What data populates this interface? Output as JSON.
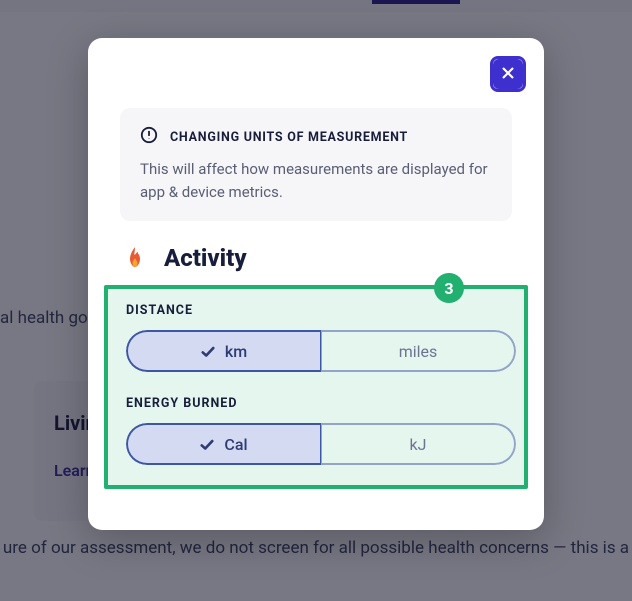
{
  "background": {
    "goal_fragment": "al health goa",
    "card_title": "Livin                              Conc",
    "card_learn": "Learn",
    "footer_text": "ure of our assessment, we do not screen for all possible health concerns — this is a"
  },
  "modal": {
    "note": {
      "title": "CHANGING UNITS OF MEASUREMENT",
      "desc": "This will affect how measurements are displayed for app & device metrics."
    },
    "section_title": "Activity",
    "badge_number": "3",
    "distance": {
      "label": "DISTANCE",
      "options": [
        "km",
        "miles"
      ],
      "selected_index": 0
    },
    "energy": {
      "label": "ENERGY BURNED",
      "options": [
        "Cal",
        "kJ"
      ],
      "selected_index": 0
    }
  }
}
